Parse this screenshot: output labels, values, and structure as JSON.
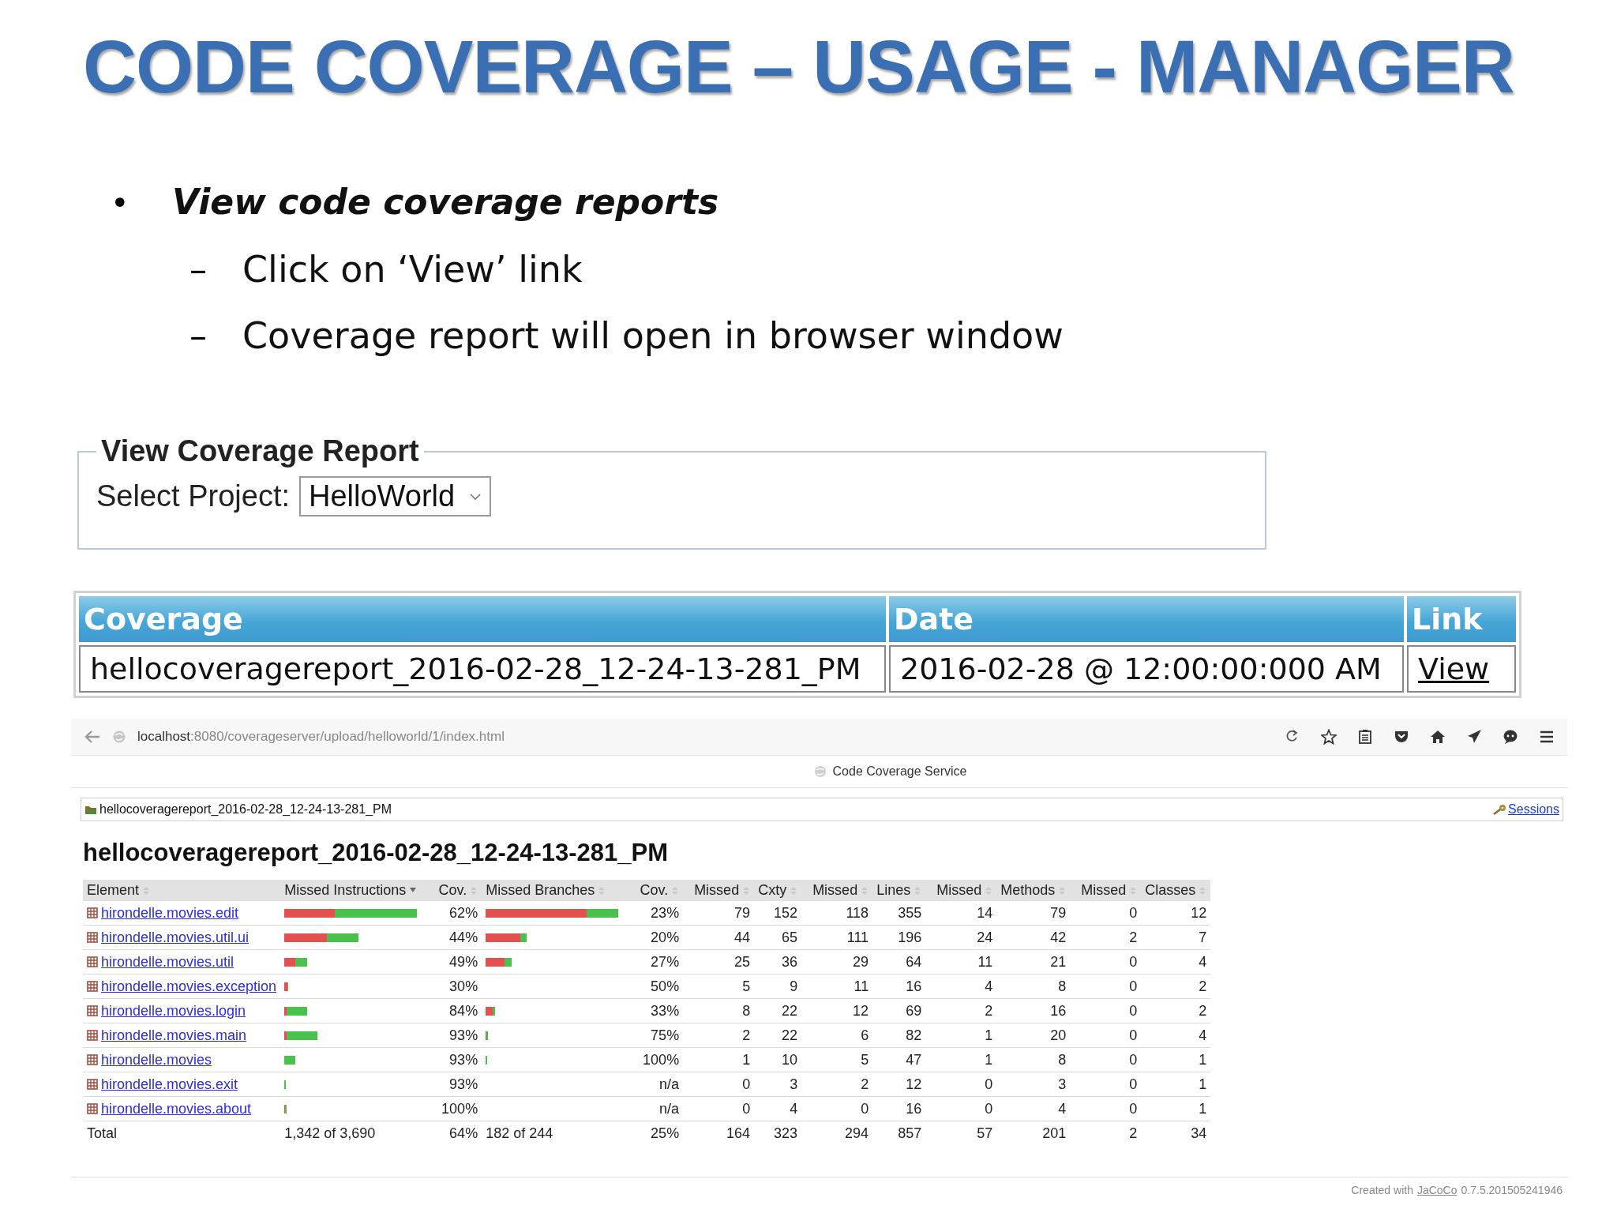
{
  "slide": {
    "title": "CODE COVERAGE – USAGE - MANAGER",
    "bullets": [
      {
        "marker": "•",
        "text": "View code coverage reports",
        "children": [
          {
            "marker": "–",
            "text": "Click on ‘View’ link"
          },
          {
            "marker": "–",
            "text": "Coverage report will open in browser window"
          }
        ]
      }
    ]
  },
  "report_form": {
    "legend": "View Coverage Report",
    "label": "Select Project:",
    "project": "HelloWorld"
  },
  "coverage_table": {
    "columns": [
      "Coverage",
      "Date",
      "Link"
    ],
    "rows": [
      {
        "coverage": "hellocoveragereport_2016-02-28_12-24-13-281_PM",
        "date": "2016-02-28 @ 12:00:00:000 AM",
        "link": "View"
      }
    ]
  },
  "browser": {
    "url_host": "localhost",
    "url_path": ":8080/coverageserver/upload/helloworld/1/index.html",
    "tab_title": "Code Coverage Service",
    "breadcrumb": "hellocoveragereport_2016-02-28_12-24-13-281_PM",
    "sessions_link": "Sessions",
    "heading": "hellocoveragereport_2016-02-28_12-24-13-281_PM",
    "report": {
      "columns": [
        {
          "label": "Element",
          "sorted": false
        },
        {
          "label": "Missed Instructions",
          "sorted": true
        },
        {
          "label": "Cov.",
          "sorted": false
        },
        {
          "label": "Missed Branches",
          "sorted": false
        },
        {
          "label": "Cov.",
          "sorted": false
        },
        {
          "label": "Missed",
          "sorted": false
        },
        {
          "label": "Cxty",
          "sorted": false
        },
        {
          "label": "Missed",
          "sorted": false
        },
        {
          "label": "Lines",
          "sorted": false
        },
        {
          "label": "Missed",
          "sorted": false
        },
        {
          "label": "Methods",
          "sorted": false
        },
        {
          "label": "Missed",
          "sorted": false
        },
        {
          "label": "Classes",
          "sorted": false
        }
      ],
      "rows": [
        {
          "element": "hirondelle.movies.edit",
          "instruction_bar": {
            "level": 1.0,
            "missed_part": {
              "level": 0.38
            }
          },
          "instruction_cov": "62%",
          "branch_bar": {
            "level": 1.0,
            "missed_part": {
              "level": 0.76
            }
          },
          "branch_cov": "23%",
          "values": [
            "79",
            "152",
            "118",
            "355",
            "14",
            "79",
            "0",
            "12"
          ]
        },
        {
          "element": "hirondelle.movies.util.ui",
          "instruction_bar": {
            "level": 0.56,
            "missed_part": {
              "level": 0.32
            }
          },
          "instruction_cov": "44%",
          "branch_bar": {
            "level": 0.31,
            "missed_part": {
              "level": 0.26
            }
          },
          "branch_cov": "20%",
          "values": [
            "44",
            "65",
            "111",
            "196",
            "24",
            "42",
            "2",
            "7"
          ]
        },
        {
          "element": "hirondelle.movies.util",
          "instruction_bar": {
            "level": 0.17,
            "missed_part": {
              "level": 0.08
            }
          },
          "instruction_cov": "49%",
          "branch_bar": {
            "level": 0.195,
            "missed_part": {
              "level": 0.14
            }
          },
          "branch_cov": "27%",
          "values": [
            "25",
            "36",
            "29",
            "64",
            "11",
            "21",
            "0",
            "4"
          ]
        },
        {
          "element": "hirondelle.movies.exception",
          "instruction_bar": {
            "level": 0.03,
            "missed_part": {
              "level": 0.02
            }
          },
          "instruction_cov": "30%",
          "branch_cov": "50%",
          "values": [
            "5",
            "9",
            "11",
            "16",
            "4",
            "8",
            "0",
            "2"
          ]
        },
        {
          "element": "hirondelle.movies.login",
          "instruction_bar": {
            "level": 0.17,
            "missed_part": {
              "level": 0.015
            }
          },
          "instruction_cov": "84%",
          "branch_bar": {
            "level": 0.07,
            "missed_part": {
              "level": 0.05
            }
          },
          "branch_cov": "33%",
          "values": [
            "8",
            "22",
            "12",
            "69",
            "2",
            "16",
            "0",
            "2"
          ]
        },
        {
          "element": "hirondelle.movies.main",
          "instruction_bar": {
            "level": 0.25,
            "missed_part": {
              "level": 0.015
            }
          },
          "instruction_cov": "93%",
          "branch_bar": {
            "level": 0.015,
            "missed_part": {
              "level": 0.005
            }
          },
          "branch_cov": "75%",
          "values": [
            "2",
            "22",
            "6",
            "82",
            "1",
            "20",
            "0",
            "4"
          ]
        },
        {
          "element": "hirondelle.movies",
          "instruction_bar": {
            "level": 0.08
          },
          "instruction_cov": "93%",
          "branch_bar": {
            "level": 0.01
          },
          "branch_cov": "100%",
          "values": [
            "1",
            "10",
            "5",
            "47",
            "1",
            "8",
            "0",
            "1"
          ]
        },
        {
          "element": "hirondelle.movies.exit",
          "instruction_bar": {
            "level": 0.01
          },
          "instruction_cov": "93%",
          "branch_cov": "n/a",
          "values": [
            "0",
            "3",
            "2",
            "12",
            "0",
            "3",
            "0",
            "1"
          ]
        },
        {
          "element": "hirondelle.movies.about",
          "instruction_bar": {
            "level": 0.015,
            "missed_part": {
              "level": 0.005
            }
          },
          "instruction_cov": "100%",
          "branch_cov": "n/a",
          "values": [
            "0",
            "4",
            "0",
            "16",
            "0",
            "4",
            "0",
            "1"
          ]
        }
      ],
      "total": {
        "label": "Total",
        "instructions": "1,342 of 3,690",
        "instruction_cov": "64%",
        "branches": "182 of 244",
        "branch_cov": "25%",
        "values": [
          "164",
          "323",
          "294",
          "857",
          "57",
          "201",
          "2",
          "34"
        ]
      }
    },
    "footer": {
      "prefix": "Created with",
      "link": "JaCoCo",
      "suffix": "0.7.5.201505241946"
    }
  }
}
